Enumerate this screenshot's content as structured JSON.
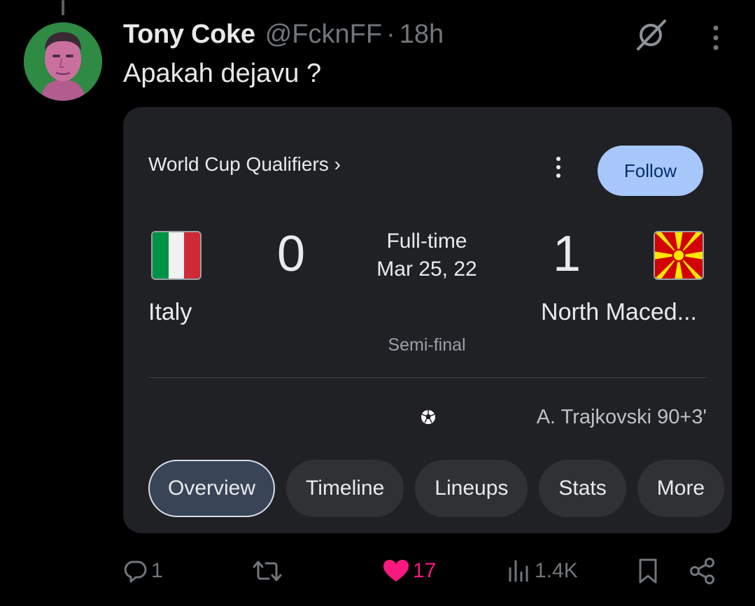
{
  "tweet": {
    "display_name": "Tony Coke",
    "handle": "@FcknFF",
    "separator": "·",
    "time": "18h",
    "text": "Apakah dejavu ?"
  },
  "match_card": {
    "competition": "World Cup Qualifiers ›",
    "follow_label": "Follow",
    "home_team": "Italy",
    "away_team": "North Maced...",
    "home_score": "0",
    "away_score": "1",
    "status": "Full-time",
    "date": "Mar 25, 22",
    "stage": "Semi-final",
    "scorer": "A. Trajkovski 90+3'",
    "tabs": [
      "Overview",
      "Timeline",
      "Lineups",
      "Stats",
      "More"
    ],
    "active_tab": "Overview"
  },
  "actions": {
    "replies": "1",
    "reposts": "",
    "likes": "17",
    "views": "1.4K"
  },
  "colors": {
    "background": "#000000",
    "card": "#202124",
    "muted": "#71767b",
    "like": "#f91880",
    "follow_bg": "#a8c7fa"
  },
  "icons": [
    "reply-icon",
    "repost-icon",
    "heart-icon",
    "views-icon",
    "bookmark-icon",
    "share-icon",
    "grok-icon",
    "more-icon",
    "soccer-ball-icon"
  ]
}
